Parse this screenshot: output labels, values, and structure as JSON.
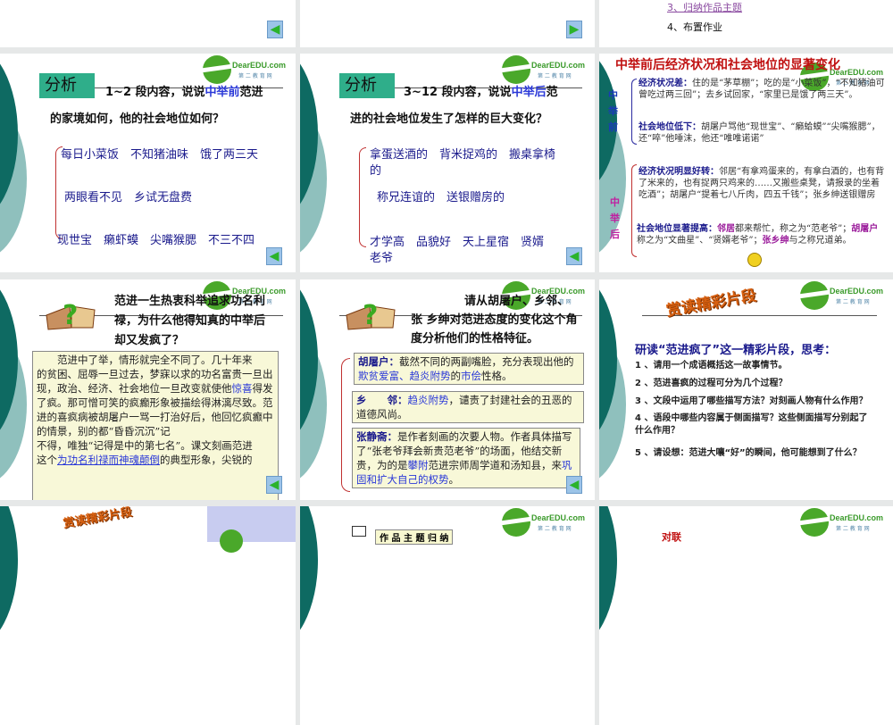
{
  "slide_r0c3": {
    "item3": "3、归纳作品主题",
    "item4": "4、布置作业"
  },
  "logo": {
    "brand": "DearEDU.com",
    "sub": "第 二 教 育 网"
  },
  "nav": {
    "back": "◀",
    "forward": "▶"
  },
  "slide_analysis1": {
    "badge": "分析",
    "q1": "1~2 段内容，说说",
    "kw": "中举前",
    "q2": "范进",
    "q3": "的家境如何，他的社会地位如何？",
    "a1": "每日小菜饭　不知猪油味　饿了两三天",
    "a2": "两眼看不见　乡试无盘费",
    "a3": "现世宝　癞虾蟆　尖嘴猴腮　不三不四"
  },
  "slide_analysis2": {
    "badge": "分析",
    "q1": "3~12 段内容，说说",
    "kw": "中举后",
    "q2": "范",
    "q3": "进的社会地位发生了怎样的巨大变化？",
    "a1": "拿蛋送酒的　背米捉鸡的　搬桌拿椅",
    "a1b": "的",
    "a2": "称兄连谊的　送银赠房的",
    "a3": "才学高　品貌好　天上星宿　贤婿",
    "a3b": "老爷"
  },
  "slide_change": {
    "title": "中举前后经济状况和社会地位的显著变化",
    "before_label": "中举前",
    "after_label": "中举后",
    "b1_head": "经济状况差：",
    "b1": "住的是“茅草棚”；吃的是“小菜饭”，“不知猪油可曾吃过两三回”；去乡试回家，“家里已是饿了两三天”。",
    "b2_head": "社会地位低下：",
    "b2": "胡屠户骂他“现世宝”、“癞蛤蟆”“尖嘴猴腮”，还“啐”他唾沫，他还“唯唯诺诺”",
    "a1_head": "经济状况明显好转：",
    "a1": "邻居“有拿鸡蛋来的，有拿白酒的，也有背了米来的，也有捉两只鸡来的……又搬些桌凳，请报录的坐着吃酒”；胡屠户“提着七八斤肉，四五千钱”；张乡绅送银赠房",
    "a2_head": "社会地位显著提高：",
    "a2_k1": "邻居",
    "a2_t1": "都来帮忙，称之为“范老爷”；",
    "a2_k2": "胡屠户",
    "a2_t2": "称之为“文曲星”、“贤婿老爷”；",
    "a2_k3": "张乡绅",
    "a2_t3": "与之称兄道弟。"
  },
  "slide_crazy": {
    "question": "范进一生热衷科举追求功名利禄，为什么他得知真的中举后却又发疯了？",
    "p1": "　　范进中了举，情形就完全不同了。几十年来",
    "p2": "的贫困、屈辱一旦过去，梦寐以求的功名富贵一旦出现，政治、经济、社会地位一旦改变就使他",
    "kw1": "惊喜",
    "p3": "得发了疯。那可憎可笑的疯癫形象被描绘得淋漓尽致。范进的喜疯病被胡屠户一骂一打治好后，他回忆疯癫中的情景，别的都“昏昏沉沉”记",
    "p4": "不得，唯独“记得是中的第七名”。课文刻画范进",
    "p5": "这个",
    "kw2": "为功名利禄而神魂颠倒",
    "p6": "的典型形象，尖锐的"
  },
  "slide_chars": {
    "question": "请从胡屠户、乡邻、张 乡绅对范进态度的变化这个角度分析他们的性格特征。",
    "c1_head": "胡屠户：",
    "c1_t1": "截然不同的两副嘴脸，充分表现出他的",
    "c1_k1": "欺贫爱富、趋炎附势",
    "c1_t2": "的",
    "c1_k2": "市侩",
    "c1_t3": "性格。",
    "c2_head": "乡　　邻：",
    "c2_k1": "趋炎附势",
    "c2_t1": "，谴责了封建社会的丑恶的道德风尚。",
    "c3_head": "张静斋：",
    "c3_t1": "是作者刻画的次要人物。作者具体描写了“张老爷拜会新贵范老爷”的场面，他结交新贵，为的是",
    "c3_k1": "攀附",
    "c3_t2": "范进宗师周学道和汤知县，来",
    "c3_k2": "巩固和扩大自己的权势",
    "c3_t3": "。"
  },
  "slide_read": {
    "wordart": "赏读精彩片段",
    "heading": "研读“范进疯了”这一精彩片段，思考：",
    "items": [
      "1 、请用一个成语概括这一故事情节。",
      "2 、范进喜疯的过程可分为几个过程？",
      "3 、文段中运用了哪些描写方法？对刻画人物有什么作用？",
      "4 、语段中哪些内容属于侧面描写？这些侧面描写分别起了什么作用？",
      "5 、请设想：范进大嚷“好”的瞬间，他可能想到了什么？"
    ]
  },
  "slide_r3c1": {
    "wordart": "赏读精彩片段"
  },
  "slide_r3c2": {
    "label": "作 品 主 题 归 纳"
  },
  "slide_r3c3": {
    "label": "对联"
  }
}
